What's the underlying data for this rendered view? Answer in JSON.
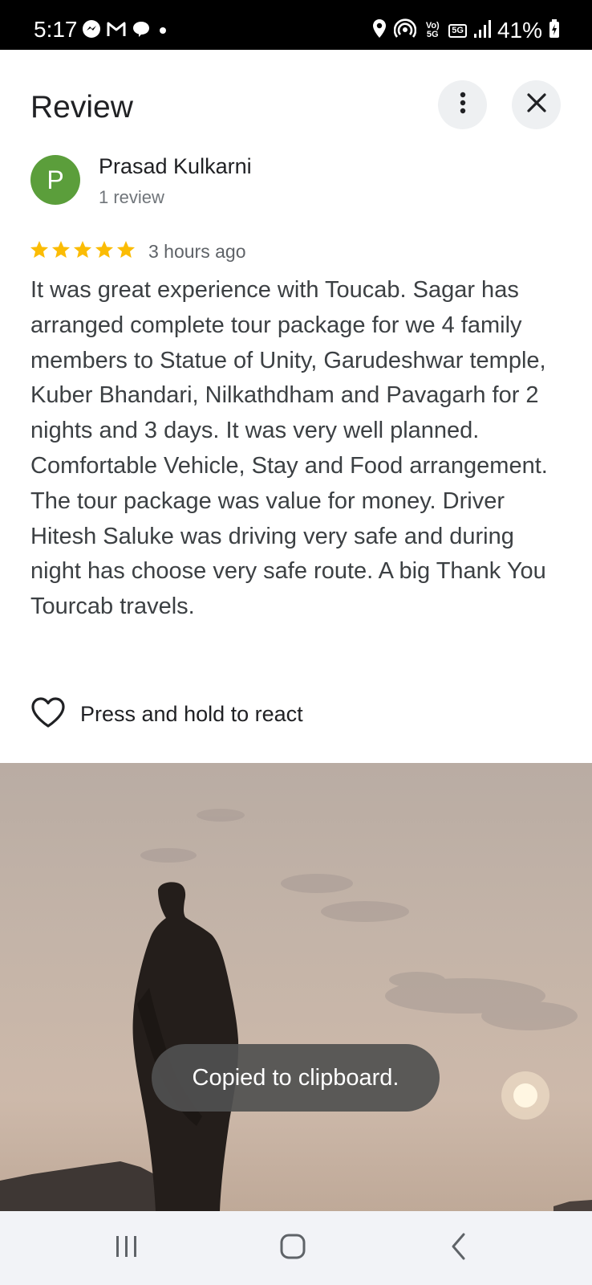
{
  "status_bar": {
    "time": "5:17",
    "battery": "41%",
    "volte_badge": "Vo)\n5G",
    "network_badge": "5G",
    "left_icons": [
      "messenger-icon",
      "gmail-icon",
      "chat-bubble-icon",
      "dot-icon"
    ],
    "right_icons": [
      "location-icon",
      "hotspot-icon",
      "volte-icon",
      "5g-icon",
      "signal-icon",
      "battery-charging-icon"
    ]
  },
  "header": {
    "title": "Review",
    "more_icon": "more-vert-icon",
    "close_icon": "close-icon"
  },
  "reviewer": {
    "initial": "P",
    "avatar_color": "#5b9e3b",
    "name": "Prasad Kulkarni",
    "review_count": "1 review"
  },
  "review": {
    "rating": 5,
    "max_rating": 5,
    "star_color": "#fbbc04",
    "time_ago": "3 hours ago",
    "text": "It was great experience with Toucab. Sagar has arranged complete tour package for we 4 family members to Statue of Unity, Garudeshwar temple, Kuber Bhandari, Nilkathdham and Pavagarh for 2 nights and 3 days. It was very well planned. Comfortable Vehicle, Stay and Food arrangement. The tour package was value for money. Driver Hitesh Saluke was driving very safe and during night has choose very safe route. A big Thank You Tourcab travels."
  },
  "react": {
    "icon": "heart-outline-icon",
    "label": "Press and hold to react"
  },
  "toast": {
    "message": "Copied to clipboard."
  },
  "nav_bar": {
    "recent_icon": "recent-apps-icon",
    "home_icon": "home-icon",
    "back_icon": "back-icon"
  }
}
